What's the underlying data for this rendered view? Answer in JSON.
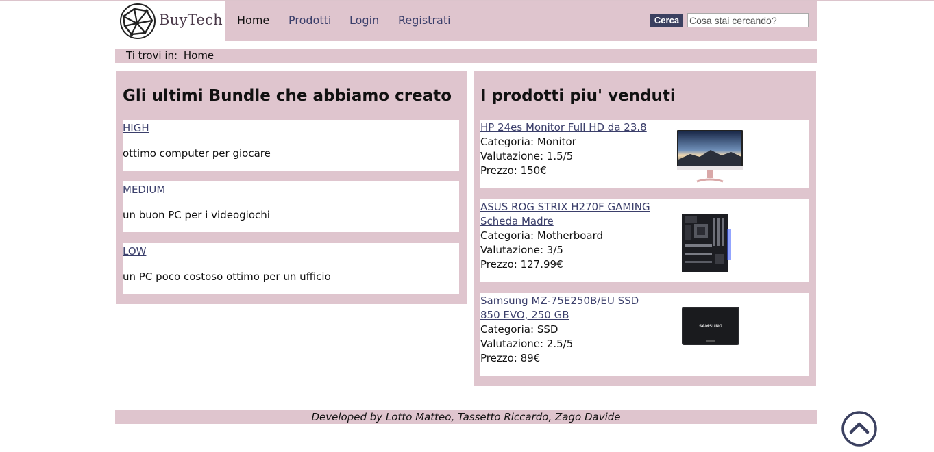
{
  "header": {
    "logo_text": "BuyTech",
    "nav": {
      "home": "Home",
      "prodotti": "Prodotti",
      "login": "Login",
      "registrati": "Registrati"
    },
    "search": {
      "button_label": "Cerca",
      "placeholder": "Cosa stai cercando?",
      "value": ""
    }
  },
  "breadcrumb": {
    "prefix": "Ti trovi in:",
    "current": "Home"
  },
  "bundles": {
    "title": "Gli ultimi Bundle che abbiamo creato",
    "items": [
      {
        "name": "HIGH",
        "description": "ottimo computer per giocare"
      },
      {
        "name": "MEDIUM",
        "description": "un buon PC per i videogiochi"
      },
      {
        "name": "LOW",
        "description": "un PC poco costoso ottimo per un ufficio"
      }
    ]
  },
  "products": {
    "title": "I prodotti piu' venduti",
    "items": [
      {
        "name_line1": "HP 24es Monitor Full HD da 23.8",
        "name_line2": "",
        "category": "Categoria: Monitor",
        "rating": "Valutazione: 1.5/5",
        "price": "Prezzo: 150€",
        "image_icon": "monitor-image"
      },
      {
        "name_line1": "ASUS ROG STRIX H270F GAMING",
        "name_line2": "Scheda Madre",
        "category": "Categoria: Motherboard",
        "rating": "Valutazione: 3/5",
        "price": "Prezzo: 127.99€",
        "image_icon": "motherboard-image"
      },
      {
        "name_line1": "Samsung MZ-75E250B/EU SSD",
        "name_line2": "850 EVO, 250 GB",
        "category": "Categoria: SSD",
        "rating": "Valutazione: 2.5/5",
        "price": "Prezzo: 89€",
        "image_icon": "ssd-image",
        "image_brand_text": "SAMSUNG"
      }
    ]
  },
  "footer": {
    "credits": "Developed by Lotto Matteo, Tassetto Riccardo, Zago Davide"
  },
  "colors": {
    "panel_bg": "#dfc5ce",
    "link": "#3b3f6b",
    "search_button": "#3b4060",
    "back_to_top": "#3b4060"
  }
}
